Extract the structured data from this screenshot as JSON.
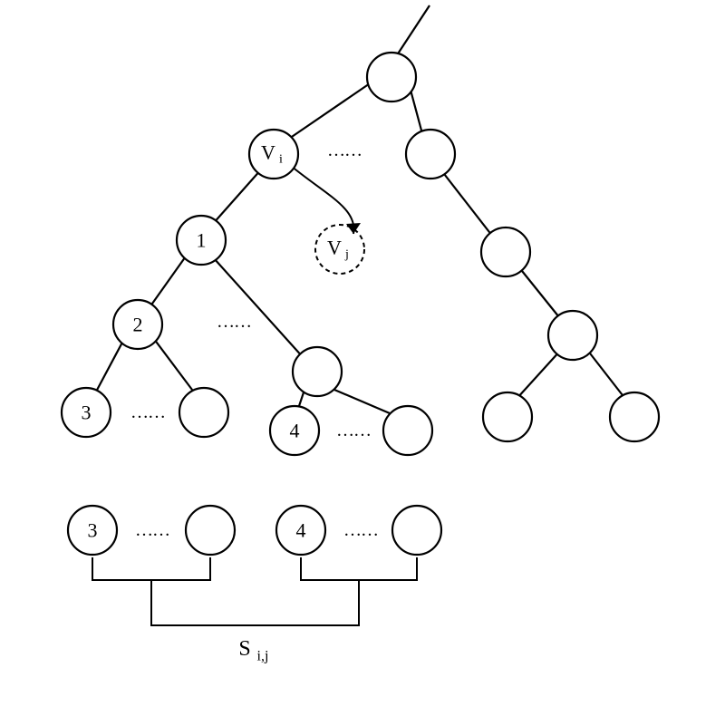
{
  "labels": {
    "vi": "V",
    "vi_sub": "i",
    "vj": "V",
    "vj_sub": "j",
    "n1": "1",
    "n2": "2",
    "n3": "3",
    "n4": "4",
    "n3b": "3",
    "n4b": "4",
    "sij": "S",
    "sij_sub": "i,j",
    "ellipsis": "……"
  }
}
